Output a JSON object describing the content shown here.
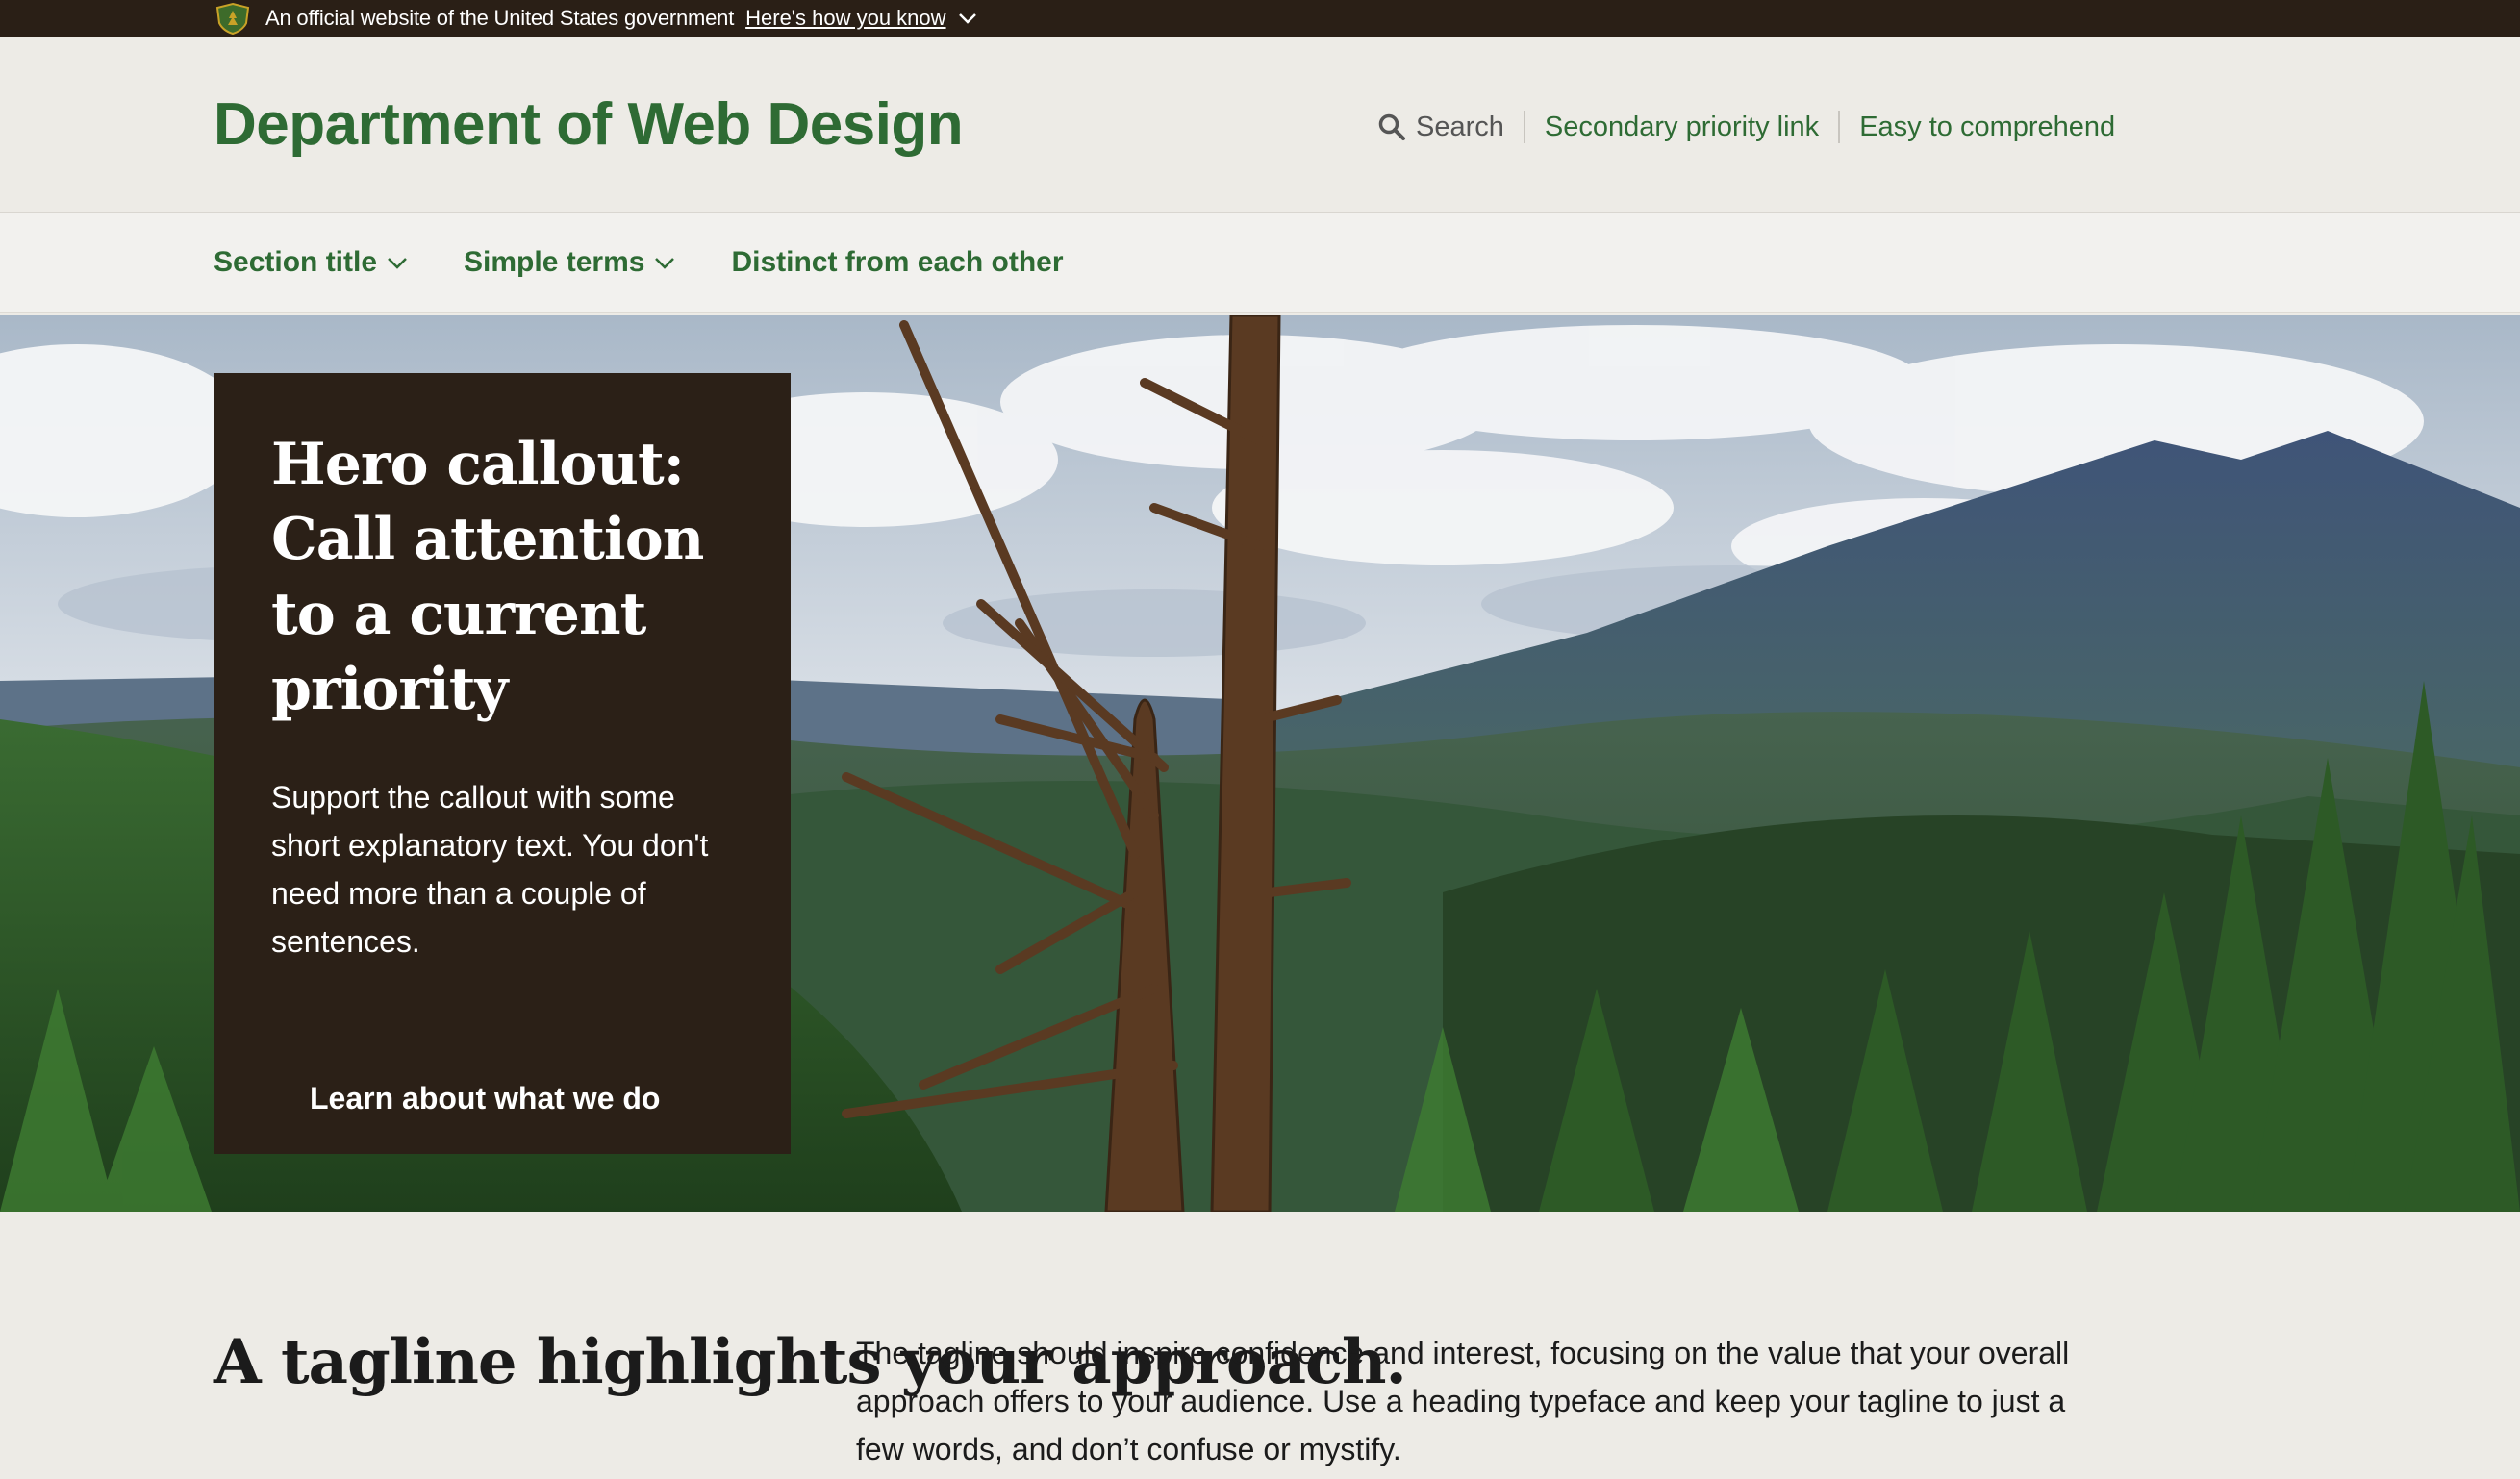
{
  "gov_banner": {
    "official_text": "An official website of the United States government",
    "how_you_know": "Here's how you know"
  },
  "header": {
    "title": "Department of Web Design",
    "utility": {
      "search_label": "Search",
      "secondary_link": "Secondary priority link",
      "easy_link": "Easy to comprehend"
    }
  },
  "primary_nav": {
    "items": [
      {
        "label": "Section title",
        "has_dropdown": true
      },
      {
        "label": "Simple terms",
        "has_dropdown": true
      },
      {
        "label": "Distinct from each other",
        "has_dropdown": false
      }
    ]
  },
  "hero": {
    "heading": "Hero callout: Call attention to a current priority",
    "body": "Support the callout with some short explanatory text. You don't need more than a couple of sentences.",
    "cta": "Learn about what we do"
  },
  "tagline": {
    "heading": "A tagline highlights your approach.",
    "body": "The tagline should inspire confidence and interest, focusing on the value that your overall approach offers to your audience. Use a heading typeface and keep your tagline to just a few words, and don’t confuse or mystify."
  },
  "colors": {
    "brand_green": "#2e6b34",
    "dark_brown": "#2b2017",
    "banner_bg": "#2a1f16",
    "page_bg": "#edebe6"
  }
}
